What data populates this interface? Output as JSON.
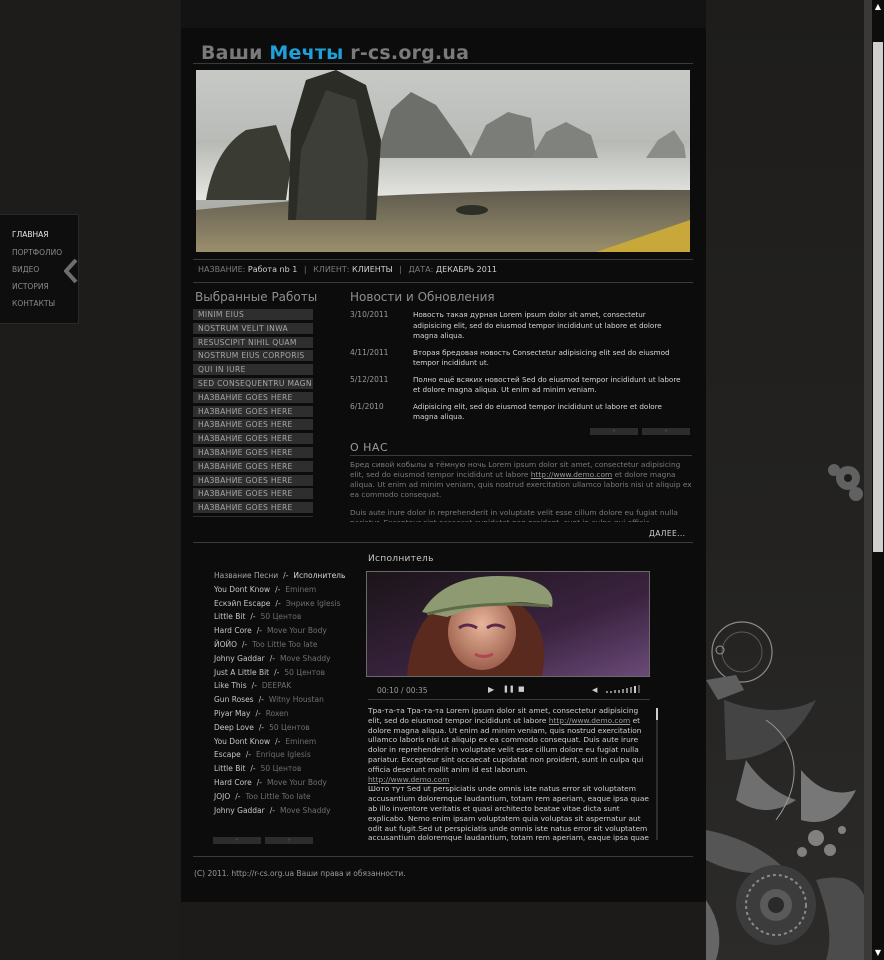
{
  "site": {
    "logo_part1": "Ваши ",
    "logo_accent": "Мечты",
    "logo_part2": " r-cs.org.ua",
    "accent_color": "#1ea0d8"
  },
  "nav": {
    "items": [
      {
        "label": "ГЛАВНАЯ",
        "active": true
      },
      {
        "label": "ПОРТФОЛИО"
      },
      {
        "label": "ВИДЕО"
      },
      {
        "label": "ИСТОРИЯ"
      },
      {
        "label": "КОНТАКТЫ"
      }
    ],
    "collapse_icon": "chevron-left-icon"
  },
  "meta": {
    "name_label": "НАЗВАНИЕ:",
    "name_value": "Работа nb 1",
    "client_label": "КЛИЕНТ:",
    "client_value": "КЛИЕНТЫ",
    "date_label": "ДАТА:",
    "date_value": "ДЕКАБРЬ 2011",
    "separator": "|"
  },
  "works": {
    "title": "Выбранные Работы",
    "items": [
      "MINIM EIUS",
      "NOSTRUM VELIT INWA",
      "RESUSCIPIT NIHIL QUAM",
      "NOSTRUM EIUS CORPORIS",
      "QUI IN IURE",
      "SED CONSEQUENTRU MAGN",
      "НАЗВАНИЕ GOES HERE",
      "НАЗВАНИЕ GOES HERE",
      "НАЗВАНИЕ GOES HERE",
      "НАЗВАНИЕ GOES HERE",
      "НАЗВАНИЕ GOES HERE",
      "НАЗВАНИЕ GOES HERE",
      "НАЗВАНИЕ GOES HERE",
      "НАЗВАНИЕ GOES HERE",
      "НАЗВАНИЕ GOES HERE",
      "НАЗВАНИЕ GOES HERE"
    ]
  },
  "news": {
    "title": "Новости и Обновления",
    "items": [
      {
        "date": "3/10/2011",
        "text": "Новость такая дурная Lorem ipsum dolor sit amet, consectetur adipisicing elit, sed do eiusmod tempor incididunt ut labore et dolore magna aliqua."
      },
      {
        "date": "4/11/2011",
        "text": "Вторая бредовая новость Consectetur adipisicing elit sed do eiusmod tempor incididunt ut."
      },
      {
        "date": "5/12/2011",
        "text": "Полно ещё всяких новостей Sed do eiusmod tempor incididunt ut labore et dolore magna aliqua. Ut enim ad minim veniam."
      },
      {
        "date": "6/1/2010",
        "text": "Adipisicing elit, sed do eiusmod tempor incididunt ut labore et dolore magna aliqua."
      }
    ],
    "prev": "‹",
    "next": "›"
  },
  "about": {
    "title": "О НАС",
    "p1_before": "Бред сивой кобылы в тёмную ночь Lorem ipsum dolor sit amet, consectetur adipisicing elit, sed do eiusmod tempor incididunt ut labore ",
    "p1_link": "http://www.demo.com",
    "p1_after": " et dolore magna aliqua. Ut enim ad minim veniam, quis nostrud exercitation ullamco laboris nisi ut aliquip ex ea commodo consequat.",
    "p2": "Duis aute irure dolor in reprehenderit in voluptate velit esse cillum dolore eu fugiat nulla pariatur. Excepteur sint occaecat cupidatat non proident, sunt in culpa qui officia",
    "more": "ДАЛЕЕ..."
  },
  "songs": {
    "header_title": "Название Песни",
    "header_artist": "Исполнитель",
    "sep": "/-",
    "items": [
      {
        "title": "You Dont Know",
        "artist": "Eminem"
      },
      {
        "title": "Ескэйп Escape",
        "artist": "Энрике Iglesis"
      },
      {
        "title": "Little Bit",
        "artist": "50 Центов"
      },
      {
        "title": "Hard Core",
        "artist": "Move Your Body"
      },
      {
        "title": "ЙОЙО",
        "artist": "Too Little Too late"
      },
      {
        "title": "Johny Gaddar",
        "artist": "Move Shaddy"
      },
      {
        "title": "Just A Little Bit",
        "artist": "50 Центов"
      },
      {
        "title": "Like This",
        "artist": "DEEPAK"
      },
      {
        "title": "Gun Roses",
        "artist": "Witny Houstan"
      },
      {
        "title": "Piyar May",
        "artist": "Roxen"
      },
      {
        "title": "Deep Love",
        "artist": "50 Центов"
      },
      {
        "title": "You Dont Know",
        "artist": "Eminem"
      },
      {
        "title": "Escape",
        "artist": "Enrique Iglesis"
      },
      {
        "title": "Little Bit",
        "artist": "50 Центов"
      },
      {
        "title": "Hard Core",
        "artist": "Move Your Body"
      },
      {
        "title": "JOJO",
        "artist": "Too Little Too late"
      },
      {
        "title": "Johny Gaddar",
        "artist": "Move Shaddy"
      }
    ],
    "prev": "‹",
    "next": "›"
  },
  "player": {
    "title": "Исполнитель",
    "current_time": "00:10",
    "time_sep": "/",
    "total_time": "00:35",
    "play_icon": "play-icon",
    "pause_icon": "pause-icon",
    "stop_icon": "stop-icon",
    "volume_icon": "volume-icon"
  },
  "lyrics": {
    "p1_before": "Тра-та-та Тра-та-та Lorem ipsum dolor sit amet, consectetur adipisicing elit, sed do eiusmod tempor incididunt ut labore ",
    "p1_link": "http://www.demo.com",
    "p1_after": " et dolore magna aliqua. Ut enim ad minim veniam, quis nostrud exercitation ullamco laboris nisi ut aliquip ex ea commodo consequat. Duis aute irure dolor in reprehenderit in voluptate velit esse cillum dolore eu fugiat nulla pariatur. Excepteur sint occaecat cupidatat non proident, sunt in culpa qui officia deserunt mollit anim id est laborum.",
    "p1_link2": "http://www.demo.com",
    "p2": " Шото тут Sed ut perspiciatis unde omnis iste natus error sit voluptatem accusantium doloremque laudantium, totam rem aperiam, eaque ipsa quae ab illo inventore veritatis et quasi architecto beatae vitae dicta sunt explicabo. Nemo enim ipsam voluptatem quia voluptas sit aspernatur aut odit aut fugit.Sed ut perspiciatis unde omnis iste natus error sit voluptatem accusantium doloremque laudantium, totam rem aperiam, eaque ipsa quae ab illo inventore veritatis et quasi architecto beatae"
  },
  "footer": {
    "text": "(C) 2011. http://r-cs.org.ua Ваши права и обязанности."
  }
}
